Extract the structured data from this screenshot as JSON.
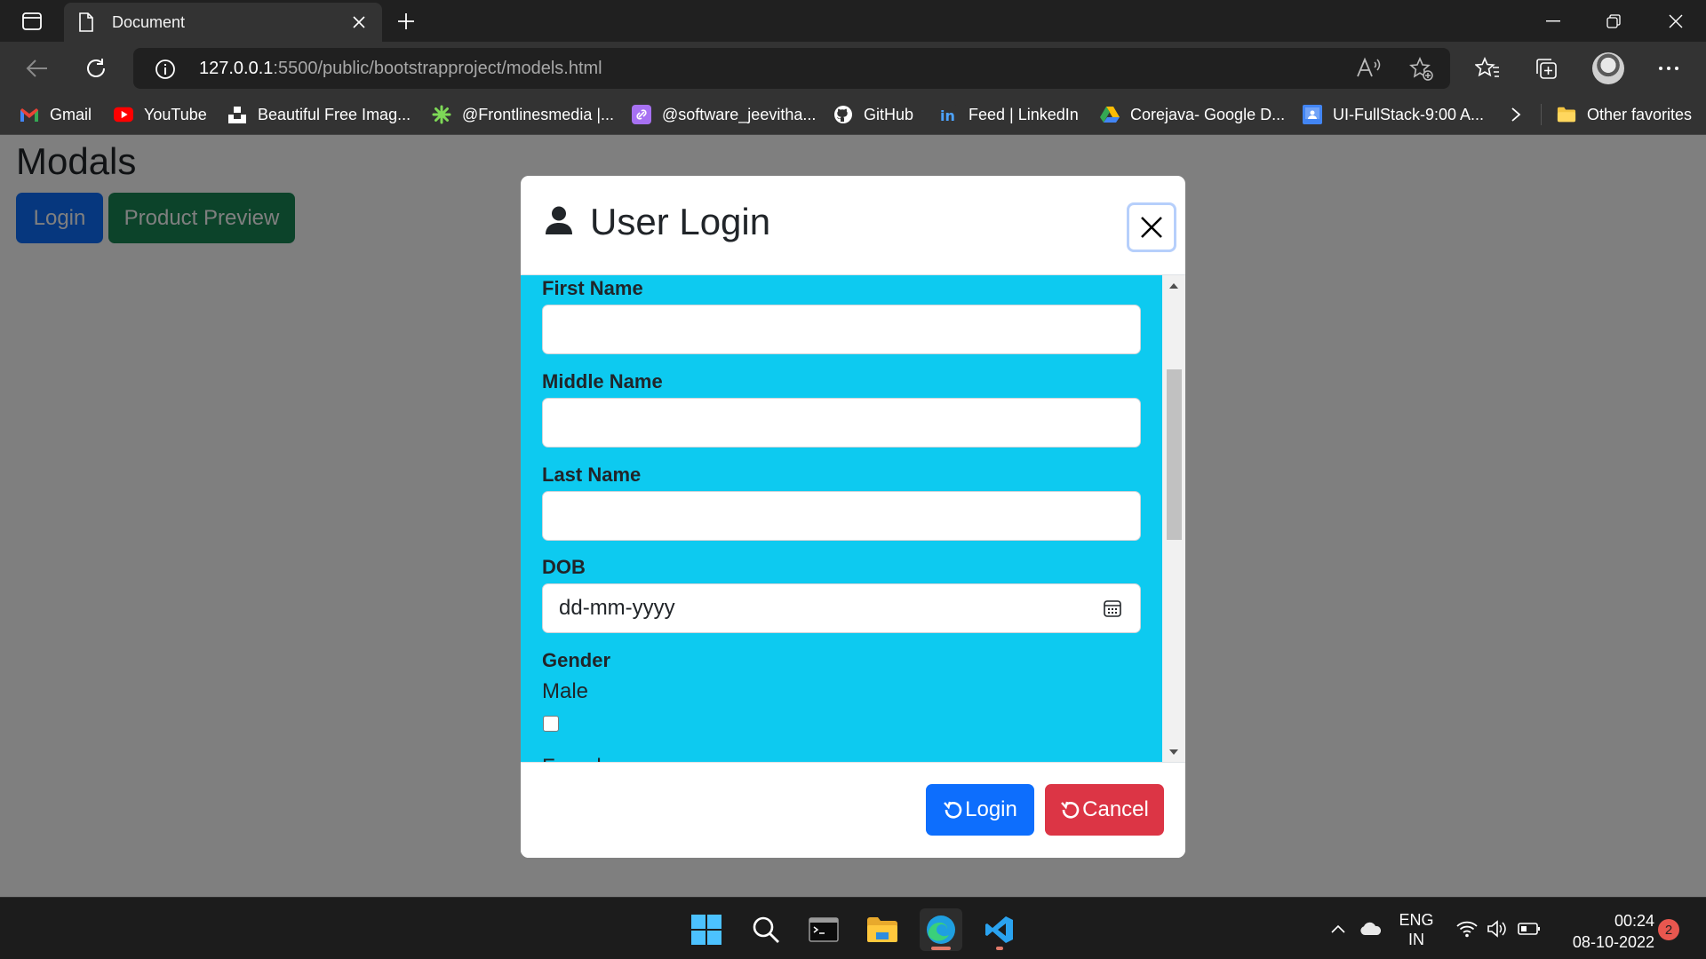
{
  "browser": {
    "tab": {
      "title": "Document"
    },
    "url": {
      "host": "127.0.0.1",
      "path": ":5500/public/bootstrapproject/models.html"
    },
    "favorites": [
      {
        "label": "Gmail",
        "icon": "gmail-icon"
      },
      {
        "label": "YouTube",
        "icon": "youtube-icon"
      },
      {
        "label": "Beautiful Free Imag...",
        "icon": "unsplash-icon"
      },
      {
        "label": "@Frontlinesmedia |...",
        "icon": "frontlines-icon"
      },
      {
        "label": "@software_jeevitha...",
        "icon": "link-icon"
      },
      {
        "label": "GitHub",
        "icon": "github-icon"
      },
      {
        "label": "Feed | LinkedIn",
        "icon": "linkedin-icon"
      },
      {
        "label": "Corejava- Google D...",
        "icon": "google-drive-icon"
      },
      {
        "label": "UI-FullStack-9:00 A...",
        "icon": "classroom-icon"
      }
    ],
    "other_favorites": "Other favorites"
  },
  "page": {
    "heading": "Modals",
    "buttons": {
      "login": "Login",
      "product_preview": "Product Preview"
    }
  },
  "modal": {
    "title": "User Login",
    "fields": {
      "first_name": "First Name",
      "middle_name": "Middle Name",
      "last_name": "Last Name",
      "dob": "DOB",
      "dob_placeholder": "dd-mm-yyyy",
      "gender": "Gender",
      "male": "Male",
      "partial_next": "Female"
    },
    "footer": {
      "login": "Login",
      "cancel": "Cancel"
    }
  },
  "taskbar": {
    "language": "ENG",
    "region": "IN",
    "time": "00:24",
    "date": "08-10-2022",
    "notifications": "2"
  },
  "colors": {
    "primary": "#0d6efd",
    "success": "#198754",
    "danger": "#dc3545",
    "info": "#0dcaf0"
  }
}
